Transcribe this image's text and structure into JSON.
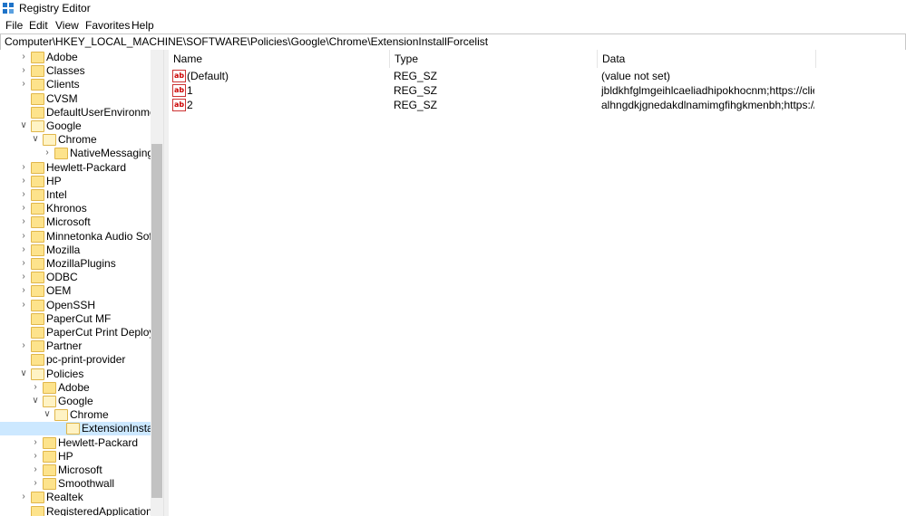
{
  "window": {
    "title": "Registry Editor",
    "icon": "registry-editor-icon"
  },
  "menu": [
    "File",
    "Edit",
    "View",
    "Favorites",
    "Help"
  ],
  "address": "Computer\\HKEY_LOCAL_MACHINE\\SOFTWARE\\Policies\\Google\\Chrome\\ExtensionInstallForcelist",
  "tree": [
    {
      "label": "Adobe",
      "expander": ">"
    },
    {
      "label": "Classes",
      "expander": ">"
    },
    {
      "label": "Clients",
      "expander": ">"
    },
    {
      "label": "CVSM",
      "expander": ""
    },
    {
      "label": "DefaultUserEnvironment",
      "expander": ""
    },
    {
      "label": "Google",
      "expander": "v"
    },
    {
      "label": "Chrome",
      "expander": "v"
    },
    {
      "label": "NativeMessagingHo",
      "expander": ">"
    },
    {
      "label": "Hewlett-Packard",
      "expander": ">"
    },
    {
      "label": "HP",
      "expander": ">"
    },
    {
      "label": "Intel",
      "expander": ">"
    },
    {
      "label": "Khronos",
      "expander": ">"
    },
    {
      "label": "Microsoft",
      "expander": ">"
    },
    {
      "label": "Minnetonka Audio Softwa",
      "expander": ">"
    },
    {
      "label": "Mozilla",
      "expander": ">"
    },
    {
      "label": "MozillaPlugins",
      "expander": ">"
    },
    {
      "label": "ODBC",
      "expander": ">"
    },
    {
      "label": "OEM",
      "expander": ">"
    },
    {
      "label": "OpenSSH",
      "expander": ">"
    },
    {
      "label": "PaperCut MF",
      "expander": ""
    },
    {
      "label": "PaperCut Print Deploy Clie",
      "expander": ""
    },
    {
      "label": "Partner",
      "expander": ">"
    },
    {
      "label": "pc-print-provider",
      "expander": ""
    },
    {
      "label": "Policies",
      "expander": "v"
    },
    {
      "label": "Adobe",
      "expander": ">"
    },
    {
      "label": "Google",
      "expander": "v"
    },
    {
      "label": "Chrome",
      "expander": "v"
    },
    {
      "label": "ExtensionInstallF",
      "expander": ""
    },
    {
      "label": "Hewlett-Packard",
      "expander": ">"
    },
    {
      "label": "HP",
      "expander": ">"
    },
    {
      "label": "Microsoft",
      "expander": ">"
    },
    {
      "label": "Smoothwall",
      "expander": ">"
    },
    {
      "label": "Realtek",
      "expander": ">"
    },
    {
      "label": "RegisteredApplications",
      "expander": ""
    }
  ],
  "columns": [
    "Name",
    "Type",
    "Data"
  ],
  "values": [
    {
      "name": "(Default)",
      "type": "REG_SZ",
      "data": "(value not set)"
    },
    {
      "name": "1",
      "type": "REG_SZ",
      "data": "jbldkhfglmgeihlcaeliadhipokhocnm;https://clients..."
    },
    {
      "name": "2",
      "type": "REG_SZ",
      "data": "alhngdkjgnedakdlnamimgfihgkmenbh;https://clie..."
    }
  ],
  "value_icon": "ab",
  "colors": {
    "selection": "#cce8ff",
    "folder": "#fde38c"
  }
}
